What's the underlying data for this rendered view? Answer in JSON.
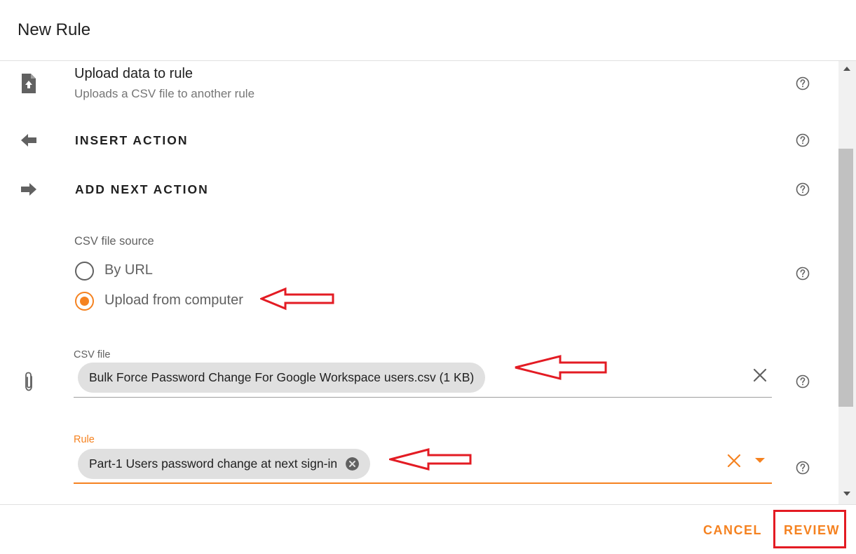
{
  "header": {
    "title": "New Rule"
  },
  "step": {
    "title": "Upload data to rule",
    "description": "Uploads a CSV file to another rule"
  },
  "actions": {
    "insert_label": "INSERT ACTION",
    "add_next_label": "ADD NEXT ACTION"
  },
  "csv_source": {
    "label": "CSV file source",
    "options": [
      {
        "label": "By URL",
        "selected": false
      },
      {
        "label": "Upload from computer",
        "selected": true
      }
    ]
  },
  "csv_file": {
    "label": "CSV file",
    "value": "Bulk Force Password Change For Google Workspace users.csv (1 KB)"
  },
  "rule": {
    "label": "Rule",
    "value": "Part-1 Users password change at next sign-in"
  },
  "footer": {
    "cancel_label": "CANCEL",
    "review_label": "REVIEW"
  },
  "colors": {
    "accent": "#f58220",
    "annotation": "#e31b23",
    "text": "#212121",
    "muted": "#616161"
  },
  "icons": [
    "file-upload-icon",
    "arrow-left-icon",
    "arrow-right-icon",
    "paperclip-icon",
    "help-icon",
    "clear-icon",
    "dropdown-icon",
    "chip-remove-icon"
  ]
}
